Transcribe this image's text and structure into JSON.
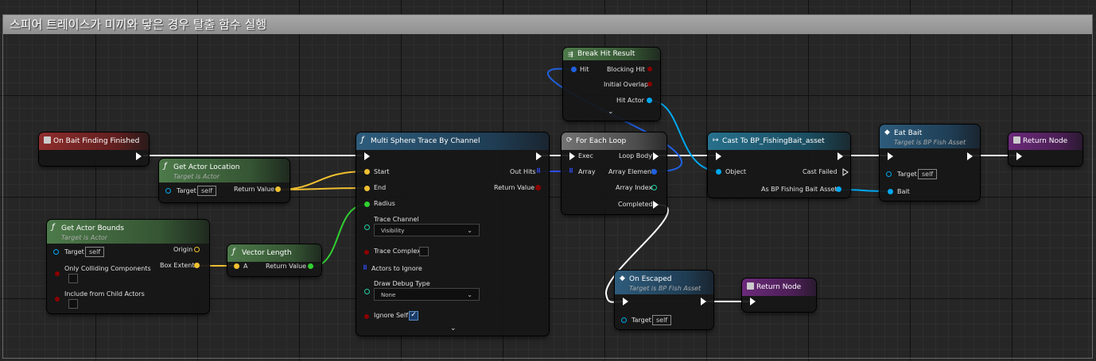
{
  "comment": {
    "title": "스피어 트레이스가 미끼와 닿은 경우 탈출 함수 실행"
  },
  "colors": {
    "exec": "#ffffff",
    "object": "#00a8f0",
    "vector": "#f0c030",
    "float": "#30d030",
    "bool": "#8b0000",
    "struct": "#3050ff",
    "int": "#20d0a0"
  },
  "nodes": {
    "event": {
      "title": "On Bait Finding Finished",
      "icon": "event-icon"
    },
    "get_actor_location": {
      "title": "Get Actor Location",
      "subtitle": "Target is Actor",
      "target": "Target",
      "target_value": "self",
      "return_value": "Return Value"
    },
    "get_actor_bounds": {
      "title": "Get Actor Bounds",
      "subtitle": "Target is Actor",
      "target": "Target",
      "target_value": "self",
      "only_colliding": "Only Colliding Components",
      "include_child": "Include from Child Actors",
      "origin": "Origin",
      "box_extent": "Box Extent"
    },
    "vector_length": {
      "title": "Vector Length",
      "a": "A",
      "return_value": "Return Value"
    },
    "sphere_trace": {
      "title": "Multi Sphere Trace By Channel",
      "start": "Start",
      "end": "End",
      "radius": "Radius",
      "trace_channel": "Trace Channel",
      "trace_channel_value": "Visibility",
      "trace_complex": "Trace Complex",
      "actors_to_ignore": "Actors to Ignore",
      "draw_debug": "Draw Debug Type",
      "draw_debug_value": "None",
      "ignore_self": "Ignore Self",
      "out_hits": "Out Hits",
      "return_value": "Return Value"
    },
    "break_hit": {
      "title": "Break Hit Result",
      "hit": "Hit",
      "blocking_hit": "Blocking Hit",
      "initial_overlap": "Initial Overlap",
      "hit_actor": "Hit Actor"
    },
    "for_each": {
      "title": "For Each Loop",
      "exec": "Exec",
      "array": "Array",
      "loop_body": "Loop Body",
      "array_element": "Array Element",
      "array_index": "Array Index",
      "completed": "Completed"
    },
    "cast": {
      "title": "Cast To BP_FishingBait_asset",
      "object": "Object",
      "cast_failed": "Cast Failed",
      "as_bait": "As BP Fishing Bait Asset"
    },
    "eat_bait": {
      "title": "Eat Bait",
      "subtitle": "Target is BP Fish Asset",
      "target": "Target",
      "target_value": "self",
      "bait": "Bait"
    },
    "return1": {
      "title": "Return Node"
    },
    "on_escaped": {
      "title": "On Escaped",
      "subtitle": "Target is BP Fish Asset",
      "target": "Target",
      "target_value": "self"
    },
    "return2": {
      "title": "Return Node"
    }
  }
}
